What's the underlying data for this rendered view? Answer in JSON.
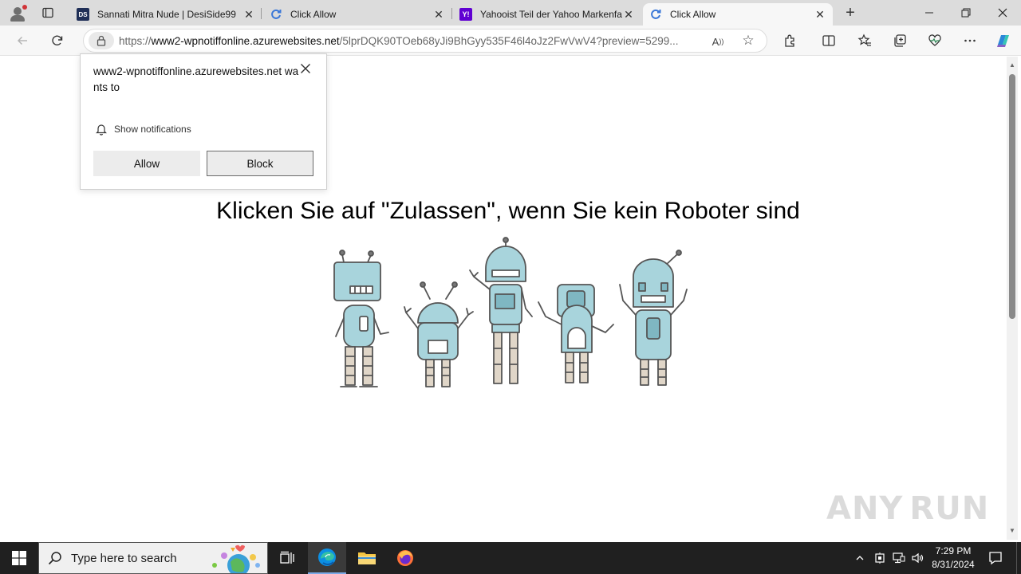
{
  "tabs": [
    {
      "title": "Sannati Mitra Nude | DesiSide99",
      "favicon": "desiside-icon",
      "favicon_text": "DS"
    },
    {
      "title": "Click Allow",
      "favicon": "reload-favicon-icon"
    },
    {
      "title": "Yahooist Teil der Yahoo Markenfa",
      "favicon": "yahoo-icon",
      "favicon_text": "Y!"
    },
    {
      "title": "Click Allow",
      "favicon": "reload-favicon-icon"
    }
  ],
  "active_tab_index": 3,
  "address_bar": {
    "protocol": "https://",
    "host": "www2-wpnotiffonline.azurewebsites.net",
    "path": "/5lprDQK90TOeb68yJi9BhGyy535F46l4oJz2FwVwV4?preview=5299..."
  },
  "permission_prompt": {
    "message": "www2-wpnotiffonline.azurewebsites.net wants to",
    "permission": "Show notifications",
    "allow_label": "Allow",
    "block_label": "Block"
  },
  "page": {
    "headline": "Klicken Sie auf \"Zulassen\", wenn Sie kein Roboter sind",
    "image": "five-cartoon-robots-illustration"
  },
  "watermark": {
    "left": "ANY",
    "right": "RUN"
  },
  "taskbar": {
    "search_placeholder": "Type here to search",
    "time": "7:29 PM",
    "date": "8/31/2024"
  },
  "colors": {
    "tabstrip": "#dcdcdc",
    "toolbar": "#f7f7f7",
    "taskbar": "#202020",
    "robot_fill": "#a8d4dc",
    "edge_accent": "#0078d4"
  }
}
